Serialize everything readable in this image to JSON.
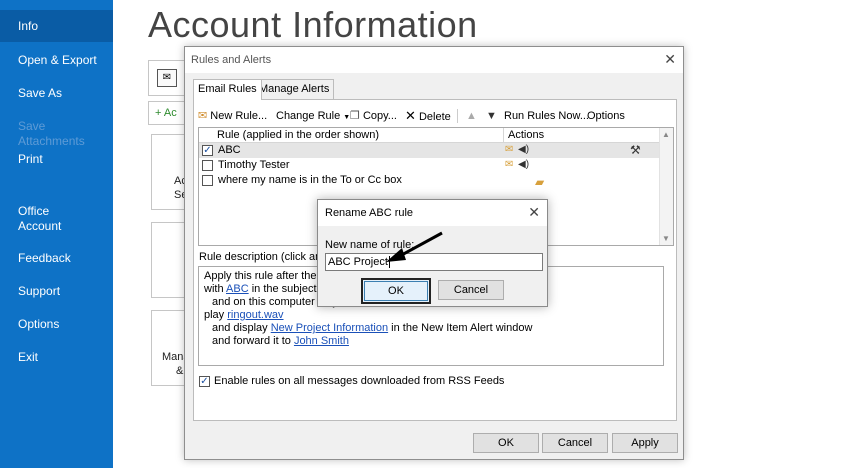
{
  "backstage": {
    "items": [
      {
        "label": "Info"
      },
      {
        "label": "Open & Export"
      },
      {
        "label": "Save As"
      },
      {
        "label": "Save Attachments"
      },
      {
        "label": "Print"
      },
      {
        "label": "Office Account"
      },
      {
        "label": "Feedback"
      },
      {
        "label": "Support"
      },
      {
        "label": "Options"
      },
      {
        "label": "Exit"
      }
    ],
    "page_title": "Account Information",
    "fragments": {
      "add": "+ Ac",
      "card1a": "Ac",
      "card1b": "Se",
      "card3a": "Mana",
      "card3b": "&"
    }
  },
  "rules_dialog": {
    "title": "Rules and Alerts",
    "tabs": [
      {
        "label": "Email Rules"
      },
      {
        "label": "Manage Alerts"
      }
    ],
    "toolbar": {
      "new_rule": "New Rule...",
      "change_rule": "Change Rule",
      "copy": "Copy...",
      "delete": "Delete",
      "run_rules_now": "Run Rules Now...",
      "options": "Options"
    },
    "columns": {
      "rule": "Rule (applied in the order shown)",
      "actions": "Actions"
    },
    "rules": [
      {
        "name": "ABC",
        "checked": true
      },
      {
        "name": "Timothy Tester",
        "checked": false
      },
      {
        "name": "where my name is in the To or Cc box",
        "checked": false
      }
    ],
    "description_label": "Rule description (click an u",
    "description": {
      "line1": "Apply this rule after the m",
      "line2_pre": "with ",
      "line2_link": "ABC",
      "line2_post": " in the subject",
      "line3": "and on this computer only",
      "line4_pre": "play ",
      "line4_link": "ringout.wav",
      "line5_pre": "and display ",
      "line5_link": "New Project Information",
      "line5_post": " in the New Item Alert window",
      "line6_pre": "and forward it to ",
      "line6_link": "John Smith"
    },
    "rss_checkbox": "Enable rules on all messages downloaded from RSS Feeds",
    "buttons": {
      "ok": "OK",
      "cancel": "Cancel",
      "apply": "Apply"
    }
  },
  "rename_dialog": {
    "title": "Rename ABC  rule",
    "label": "New name of rule:",
    "value": "ABC Project",
    "ok": "OK",
    "cancel": "Cancel"
  },
  "colors": {
    "accent": "#0e72c6",
    "link": "#1a50b8"
  }
}
